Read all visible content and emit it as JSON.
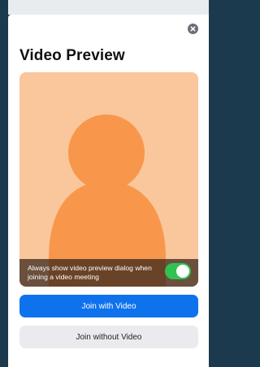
{
  "dialog": {
    "title": "Video Preview",
    "close_icon": "close-icon"
  },
  "preview": {
    "avatar_icon": "person-silhouette-icon",
    "background_color": "#f9c79b",
    "avatar_color": "#f8974b",
    "overlay_text": "Always show video preview dialog when joining a video meeting",
    "toggle_on": true,
    "toggle_color": "#30c352"
  },
  "buttons": {
    "join_with_video": "Join with Video",
    "join_without_video": "Join without Video"
  },
  "colors": {
    "primary": "#0e72ed",
    "secondary_bg": "#ebebef"
  }
}
